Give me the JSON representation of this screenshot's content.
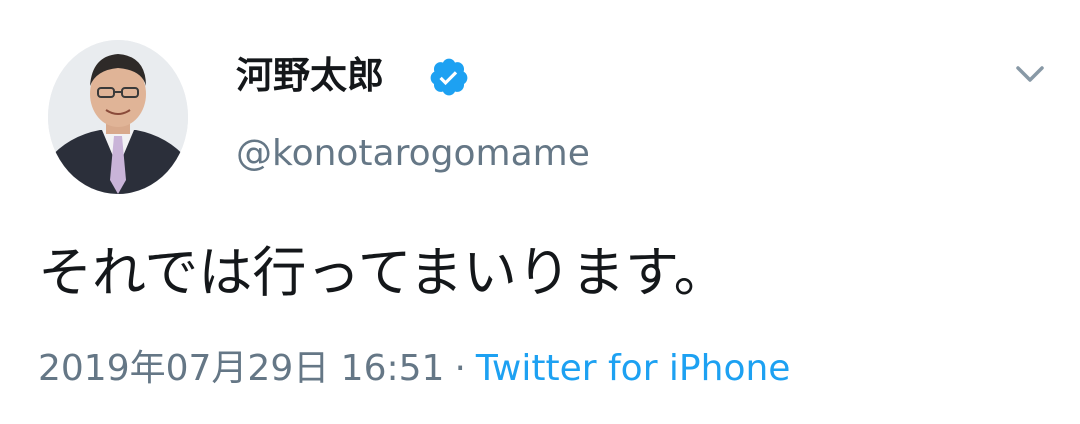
{
  "tweet": {
    "display_name": "河野太郎",
    "handle": "@konotarogomame",
    "verified": true,
    "text": "それでは行ってまいります。",
    "timestamp": "2019年07月29日 16:51",
    "separator": "·",
    "source": "Twitter for iPhone"
  },
  "icons": {
    "verified": "verified-badge-icon",
    "more": "chevron-down-icon"
  },
  "colors": {
    "name": "#14171a",
    "secondary": "#657786",
    "link": "#1da1f2",
    "verified_badge": "#1da1f2"
  }
}
